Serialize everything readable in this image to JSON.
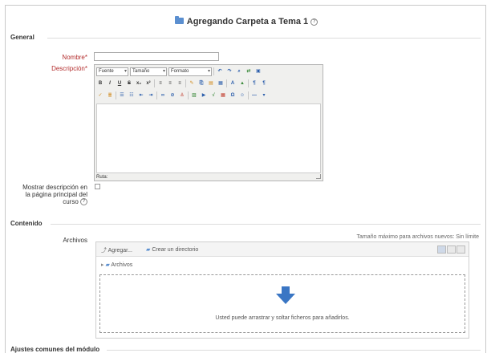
{
  "page": {
    "title": "Agregando Carpeta a Tema 1",
    "help_symbol": "?"
  },
  "sections": {
    "general": "General",
    "contenido": "Contenido",
    "ajustes": "Ajustes comunes del módulo"
  },
  "form": {
    "nombre_label": "Nombre",
    "descripcion_label": "Descripción",
    "required_mark": "*",
    "mostrar_label_1": "Mostrar descripción en",
    "mostrar_label_2": "la página principal del",
    "mostrar_label_3": "curso",
    "nombre_value": ""
  },
  "editor": {
    "font_select": "Fuente",
    "size_select": "Tamaño",
    "format_select": "Formato",
    "path_label": "Ruta:"
  },
  "files": {
    "label": "Archivos",
    "max_size_text": "Tamaño máximo para archivos nuevos: Sin límite",
    "add_button": "Agregar...",
    "create_dir_button": "Crear un directorio",
    "breadcrumb_folder": "Archivos",
    "drop_message": "Usted puede arrastrar y soltar ficheros para añadirlos."
  },
  "colors": {
    "required": "#b32d2d",
    "folder_icon": "#5b8fd0",
    "drop_arrow": "#3a76c4"
  }
}
